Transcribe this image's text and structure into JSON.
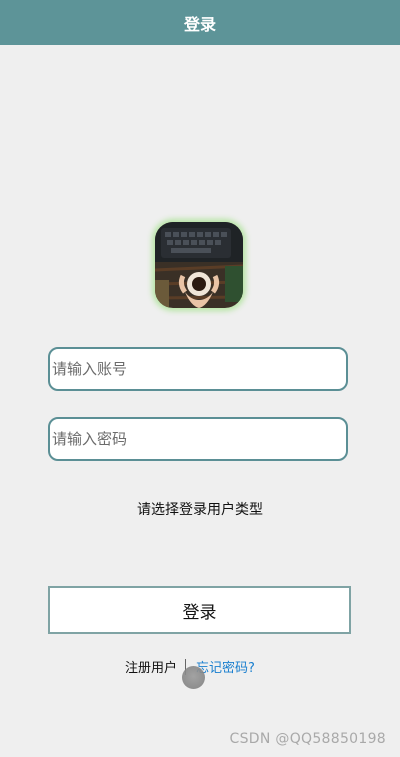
{
  "header": {
    "title": "登录"
  },
  "form": {
    "account_placeholder": "请输入账号",
    "password_placeholder": "请输入密码",
    "user_type_prompt": "请选择登录用户类型",
    "login_button": "登录"
  },
  "links": {
    "register": "注册用户",
    "forgot_password": "忘记密码?"
  },
  "watermark": "CSDN @QQ58850198",
  "colors": {
    "header_bg": "#5d9498",
    "background": "#efefef",
    "field_border": "#5b8f95",
    "link_blue": "#1a7fcf"
  }
}
